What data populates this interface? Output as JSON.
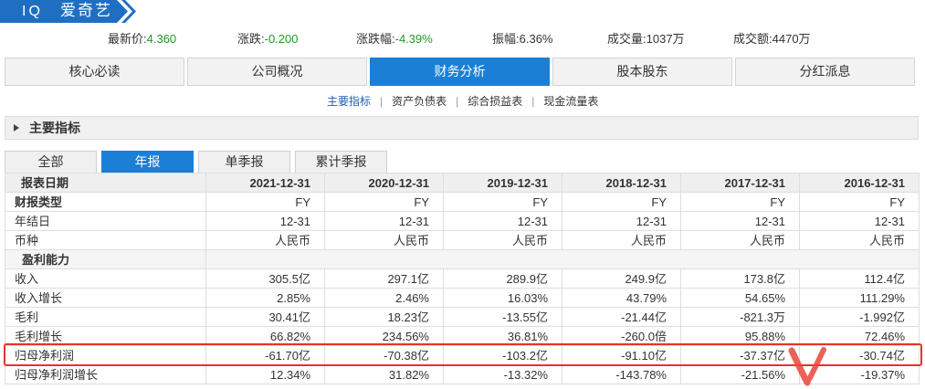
{
  "header": {
    "ticker": "IQ",
    "name": "爱奇艺"
  },
  "quote": {
    "last_price": {
      "label": "最新价:",
      "value": "4.360"
    },
    "change": {
      "label": "涨跌:",
      "value": "-0.200"
    },
    "change_pct": {
      "label": "涨跌幅:",
      "value": "-4.39%"
    },
    "amplitude": {
      "label": "振幅:",
      "value": "6.36%"
    },
    "volume": {
      "label": "成交量:",
      "value": "1037万"
    },
    "turnover": {
      "label": "成交额:",
      "value": "4470万"
    }
  },
  "main_tabs": [
    {
      "label": "核心必读"
    },
    {
      "label": "公司概况"
    },
    {
      "label": "财务分析",
      "active": true
    },
    {
      "label": "股本股东"
    },
    {
      "label": "分红派息"
    }
  ],
  "sub_links": [
    {
      "label": "主要指标",
      "active": true
    },
    {
      "label": "资产负债表"
    },
    {
      "label": "综合损益表"
    },
    {
      "label": "现金流量表"
    }
  ],
  "sub_link_separator": "|",
  "section": {
    "title": "主要指标",
    "toggle_icon": "triangle-right-icon"
  },
  "report_tabs": [
    {
      "label": "全部"
    },
    {
      "label": "年报",
      "active": true
    },
    {
      "label": "单季报"
    },
    {
      "label": "累计季报"
    }
  ],
  "table": {
    "header_label": "报表日期",
    "dates": [
      "2021-12-31",
      "2020-12-31",
      "2019-12-31",
      "2018-12-31",
      "2017-12-31",
      "2016-12-31"
    ],
    "rows": [
      {
        "label": "财报类型",
        "values": [
          "FY",
          "FY",
          "FY",
          "FY",
          "FY",
          "FY"
        ]
      },
      {
        "label": "年结日",
        "values": [
          "12-31",
          "12-31",
          "12-31",
          "12-31",
          "12-31",
          "12-31"
        ]
      },
      {
        "label": "币种",
        "values": [
          "人民币",
          "人民币",
          "人民币",
          "人民币",
          "人民币",
          "人民币"
        ]
      },
      {
        "label": "盈利能力",
        "section": true
      },
      {
        "label": "收入",
        "values": [
          "305.5亿",
          "297.1亿",
          "289.9亿",
          "249.9亿",
          "173.8亿",
          "112.4亿"
        ]
      },
      {
        "label": "收入增长",
        "values": [
          "2.85%",
          "2.46%",
          "16.03%",
          "43.79%",
          "54.65%",
          "111.29%"
        ]
      },
      {
        "label": "毛利",
        "values": [
          "30.41亿",
          "18.23亿",
          "-13.55亿",
          "-21.44亿",
          "-821.3万",
          "-1.992亿"
        ]
      },
      {
        "label": "毛利增长",
        "values": [
          "66.82%",
          "234.56%",
          "36.81%",
          "-260.0倍",
          "95.88%",
          "72.46%"
        ]
      },
      {
        "label": "归母净利润",
        "values": [
          "-61.70亿",
          "-70.38亿",
          "-103.2亿",
          "-91.10亿",
          "-37.37亿",
          "-30.74亿"
        ],
        "highlighted": true
      },
      {
        "label": "归母净利润增长",
        "values": [
          "12.34%",
          "31.82%",
          "-13.32%",
          "-143.78%",
          "-21.56%",
          "-19.37%"
        ]
      }
    ]
  },
  "colors": {
    "accent": "#1b7fd6",
    "banner": "#1e6fc2",
    "down": "#1f9a24",
    "link": "#1e5fb0",
    "highlight": "#e0352e"
  }
}
